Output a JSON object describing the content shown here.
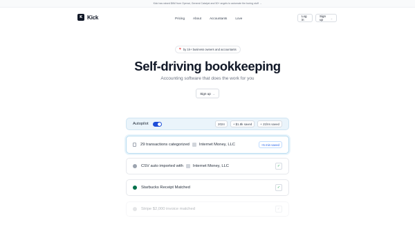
{
  "announcement": "Kick has raised $6M from Openai, General Catalyst and 50+ angels to automate the boring stuff →",
  "brand": {
    "logo_glyph": "K",
    "name": "Kick"
  },
  "nav": {
    "links": [
      "Pricing",
      "About",
      "Accountants",
      "Love"
    ],
    "login_label": "Log in",
    "signup_label": "Sign up"
  },
  "hero": {
    "badge_icon": "heart-icon",
    "badge_text": "by 1k+ business owners and accountants",
    "title": "Self-driving bookkeeping",
    "subtitle": "Accounting software that does the work for you",
    "cta_label": "Sign up"
  },
  "autopilot": {
    "label": "Autopilot",
    "toggle_on": true,
    "year": "2024",
    "saved_money": "+ $1.8k saved",
    "saved_time": "+ 21hrs saved"
  },
  "activity": [
    {
      "icon": "document-icon",
      "text": "29 transactions categorized",
      "account": "Internet Money, LLC",
      "badge": "+5 min saved"
    },
    {
      "icon": "circle-icon",
      "text": "CSV auto imported with",
      "account": "Internet Money, LLC",
      "status": "check-icon"
    },
    {
      "icon": "starbucks-icon",
      "text": "Starbucks Receipt Matched",
      "status": "check-icon"
    },
    {
      "icon": "stripe-icon",
      "text": "Stripe $2,000 invoice matched",
      "status": "check-icon"
    }
  ],
  "colors": {
    "accent": "#1d4ed8",
    "autopilot_bg": "#eaf4fb",
    "success": "#16a34a",
    "heart": "#ef4444"
  }
}
